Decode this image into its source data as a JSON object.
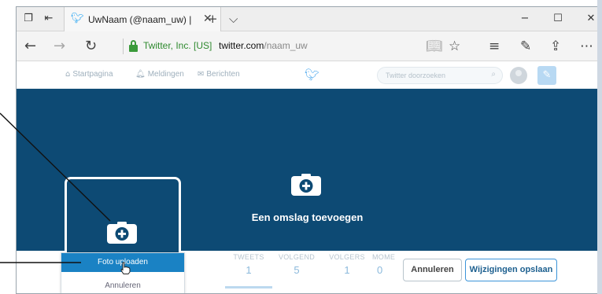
{
  "browser": {
    "tab_title": "UwNaam (@naam_uw) |",
    "tab_close": "✕",
    "new_tab": "+",
    "tab_list": "⌵",
    "window_controls": {
      "minimize": "−",
      "maximize": "☐",
      "close": "✕"
    },
    "nav": {
      "back": "←",
      "forward": "→",
      "refresh": "↻"
    },
    "cert_owner": "Twitter, Inc. [US]",
    "url_domain": "twitter.com",
    "url_path": "/naam_uw",
    "toolbar_icons": [
      "reading-view-icon",
      "favorite-star-icon",
      "hub-icon",
      "web-note-icon",
      "share-icon",
      "more-icon"
    ]
  },
  "twitter": {
    "nav_items": [
      {
        "label": "Startpagina",
        "icon": "home-icon"
      },
      {
        "label": "Meldingen",
        "icon": "bell-icon"
      },
      {
        "label": "Berichten",
        "icon": "envelope-icon"
      }
    ],
    "search_placeholder": "Twitter doorzoeken",
    "cover_label": "Een omslag toevoegen",
    "stats": [
      {
        "label": "TWEETS",
        "value": "1"
      },
      {
        "label": "VOLGEND",
        "value": "5"
      },
      {
        "label": "VOLGERS",
        "value": "1"
      },
      {
        "label": "MOME",
        "value": "0"
      }
    ],
    "cancel_button": "Annuleren",
    "save_button": "Wijzigingen opslaan",
    "menu": {
      "upload": "Foto uploaden",
      "cancel": "Annuleren"
    }
  },
  "colors": {
    "cover": "#0d4a74",
    "menu_highlight": "#1a82c4",
    "secure_green": "#2f8a2f",
    "twitter_blue": "#55acee"
  }
}
